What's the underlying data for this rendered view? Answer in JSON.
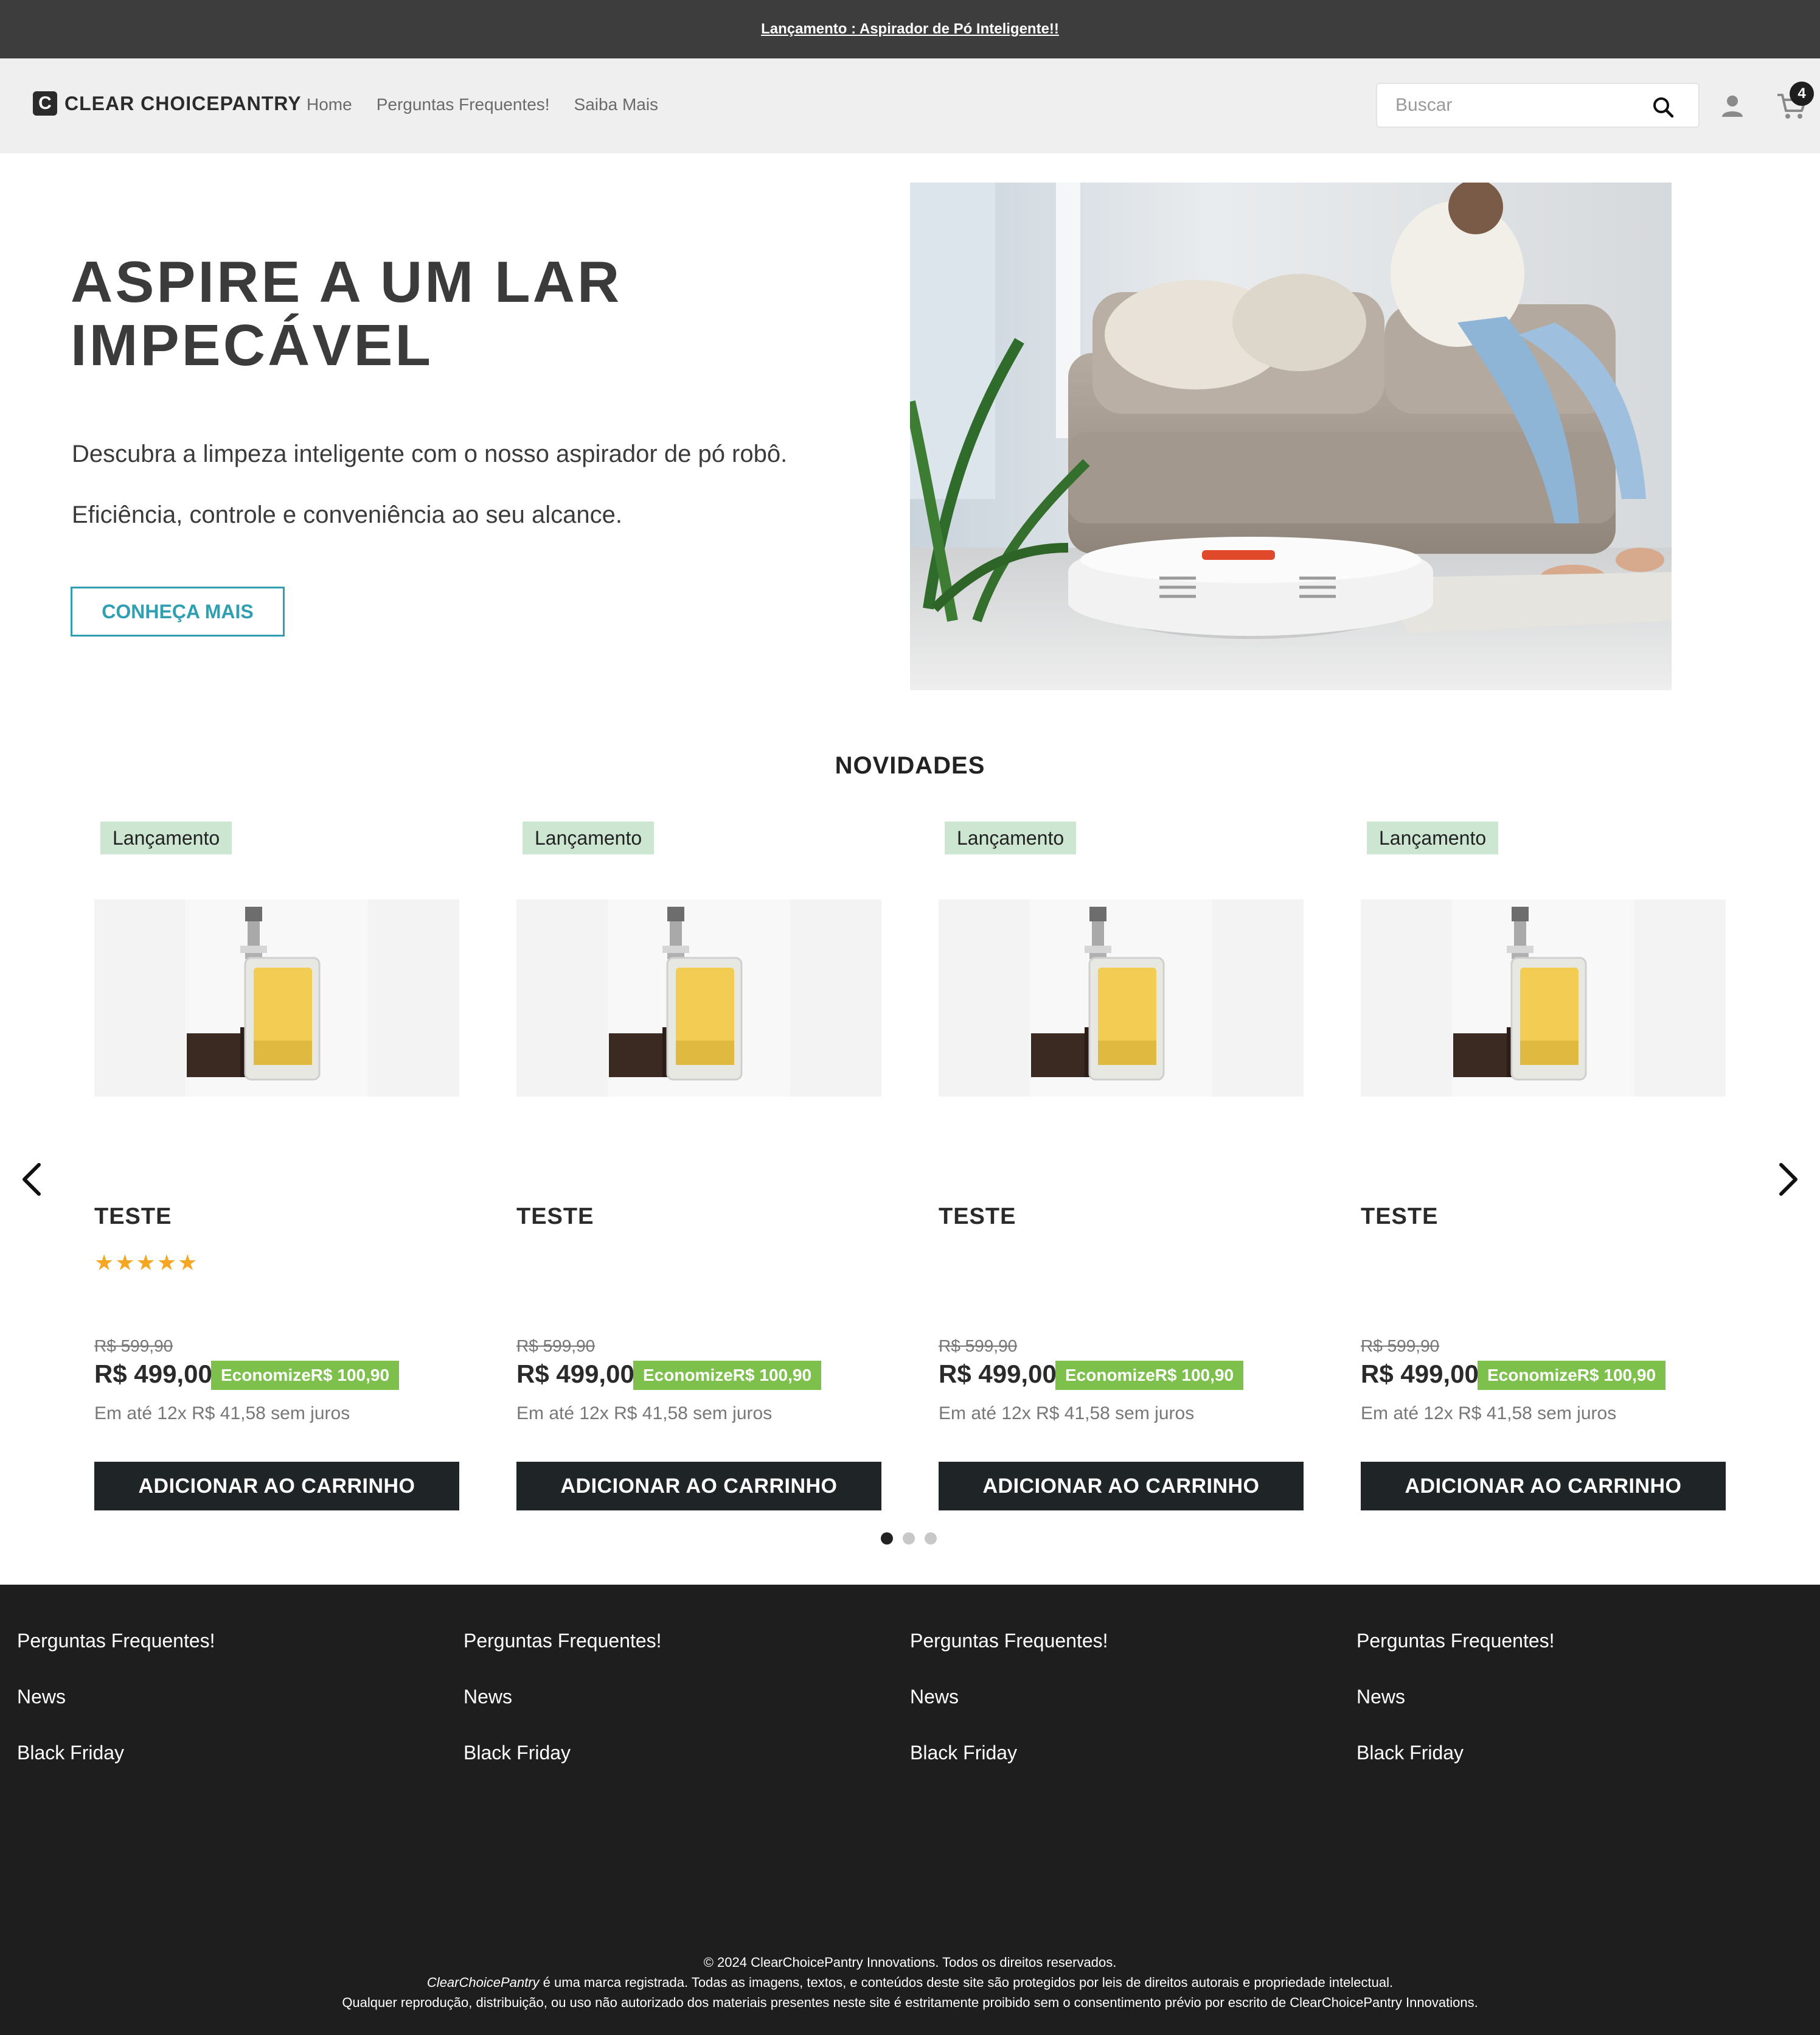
{
  "announcement": {
    "text": "Lançamento : Aspirador de Pó Inteligente!!"
  },
  "header": {
    "logo_mark": "C",
    "logo_text": "CLEAR CHOICEPANTRY",
    "nav": [
      "Home",
      "Perguntas Frequentes!",
      "Saiba Mais"
    ],
    "search_placeholder": "Buscar",
    "cart_count": "4"
  },
  "hero": {
    "title_line1": "ASPIRE A UM LAR",
    "title_line2": "IMPECÁVEL",
    "paragraph1": "Descubra a limpeza inteligente com o nosso aspirador de pó robô.",
    "paragraph2": "Eficiência, controle e conveniência ao seu alcance.",
    "button": "CONHEÇA MAIS"
  },
  "section": {
    "title": "NOVIDADES"
  },
  "products": [
    {
      "badge": "Lançamento",
      "name": "TESTE",
      "stars": "★★★★★",
      "old_price": "R$ 599,90",
      "price": "R$ 499,00",
      "save": "EconomizeR$ 100,90",
      "installments": "Em até 12x R$ 41,58 sem juros",
      "button": "ADICIONAR AO CARRINHO"
    },
    {
      "badge": "Lançamento",
      "name": "TESTE",
      "stars": "",
      "old_price": "R$ 599,90",
      "price": "R$ 499,00",
      "save": "EconomizeR$ 100,90",
      "installments": "Em até 12x R$ 41,58 sem juros",
      "button": "ADICIONAR AO CARRINHO"
    },
    {
      "badge": "Lançamento",
      "name": "TESTE",
      "stars": "",
      "old_price": "R$ 599,90",
      "price": "R$ 499,00",
      "save": "EconomizeR$ 100,90",
      "installments": "Em até 12x R$ 41,58 sem juros",
      "button": "ADICIONAR AO CARRINHO"
    },
    {
      "badge": "Lançamento",
      "name": "TESTE",
      "stars": "",
      "old_price": "R$ 599,90",
      "price": "R$ 499,00",
      "save": "EconomizeR$ 100,90",
      "installments": "Em até 12x R$ 41,58 sem juros",
      "button": "ADICIONAR AO CARRINHO"
    }
  ],
  "carousel": {
    "pages": 3,
    "active_page": 1
  },
  "footer": {
    "columns": [
      [
        "Perguntas Frequentes!",
        "News",
        "Black Friday"
      ],
      [
        "Perguntas Frequentes!",
        "News",
        "Black Friday"
      ],
      [
        "Perguntas Frequentes!",
        "News",
        "Black Friday"
      ],
      [
        "Perguntas Frequentes!",
        "News",
        "Black Friday"
      ]
    ],
    "copyright": "© 2024 ClearChoicePantry Innovations. Todos os direitos reservados.",
    "brand_italic": "ClearChoicePantry",
    "trademark": " é uma marca registrada. Todas as imagens, textos, e conteúdos deste site são protegidos por leis de direitos autorais e propriedade intelectual.",
    "reproduction": "Qualquer reprodução, distribuição, ou uso não autorizado dos materiais presentes neste site é estritamente proibido sem o consentimento prévio por escrito de ClearChoicePantry Innovations."
  },
  "colors": {
    "announcement_bg": "#3d3d3d",
    "header_bg": "#efefef",
    "accent": "#2f9fb1",
    "badge_bg": "#cde6d2",
    "save_bg": "#7dc04b",
    "button_bg": "#1f2526",
    "footer_bg": "#1e1e1e",
    "star": "#f5a623"
  }
}
